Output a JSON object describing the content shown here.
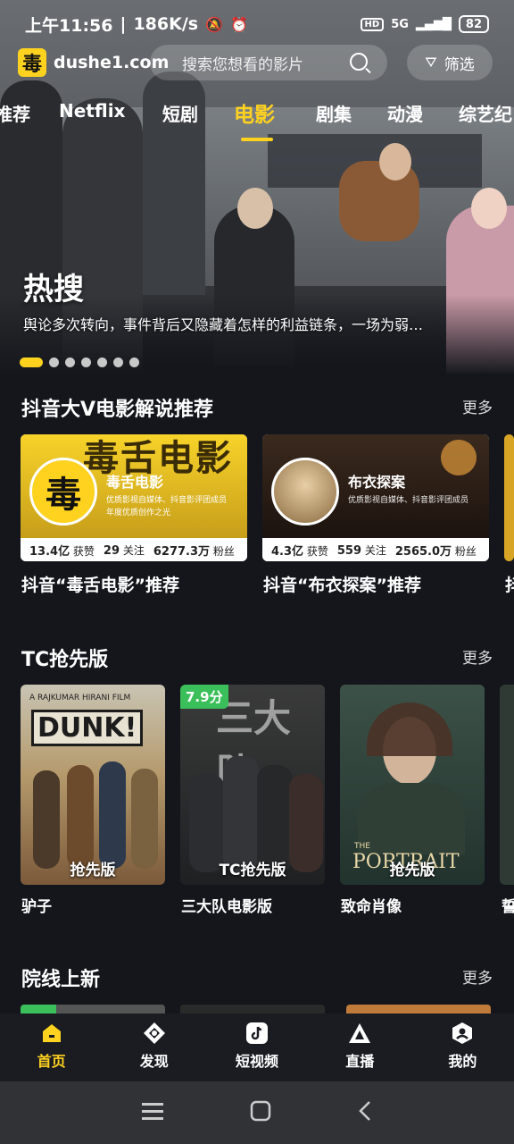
{
  "status_bar": {
    "time": "上午11:56",
    "speed": "186K/s",
    "hd": "HD",
    "network": "5G",
    "battery": "82"
  },
  "header": {
    "site": "dushe1.com",
    "logo_char": "毒",
    "search_placeholder": "搜索您想看的影片",
    "filter_label": "筛选"
  },
  "tabs": [
    "推荐",
    "Netflix",
    "短剧",
    "电影",
    "剧集",
    "动漫",
    "综艺纪"
  ],
  "active_tab": "电影",
  "hero": {
    "title": "热搜",
    "description": "舆论多次转向，事件背后又隐藏着怎样的利益链条，一场为弱…",
    "slide_count": 7,
    "active_slide": 0
  },
  "sections": {
    "v_title": "抖音大V电影解说推荐",
    "v_more": "更多",
    "v_cards": [
      {
        "banner": "毒舌电影",
        "name": "毒舌电影",
        "line1": "优质影视自媒体、抖音影评团成员",
        "line2": "年度优质创作之光",
        "likes": "13.4亿",
        "likes_label": "获赞",
        "follows": "29",
        "follows_label": "关注",
        "fans": "6277.3万",
        "fans_label": "粉丝",
        "caption": "抖音“毒舌电影”推荐"
      },
      {
        "banner": "",
        "name": "布衣探案",
        "line1": "优质影视自媒体、抖音影评团成员",
        "line2": "",
        "likes": "4.3亿",
        "likes_label": "获赞",
        "follows": "559",
        "follows_label": "关注",
        "fans": "2565.0万",
        "fans_label": "粉丝",
        "caption": "抖音“布衣探案”推荐"
      }
    ],
    "v_caption_partial": "抖",
    "tc_title": "TC抢先版",
    "tc_more": "更多",
    "tc_movies": [
      {
        "title": "驴子",
        "tag": "抢先版",
        "poster_text": "DUNK!",
        "poster_credit": "A RAJKUMAR HIRANI FILM",
        "score": ""
      },
      {
        "title": "三大队电影版",
        "tag": "TC抢先版",
        "poster_text": "三大队",
        "poster_credit": "",
        "score": "7.9分"
      },
      {
        "title": "致命肖像",
        "tag": "抢先版",
        "poster_text": "PORTRAIT",
        "poster_credit": "THE",
        "score": ""
      }
    ],
    "tc_caption_partial": "誓",
    "new_title": "院线上新",
    "new_more": "更多"
  },
  "bottom_nav": [
    {
      "label": "首页",
      "icon": "home-icon"
    },
    {
      "label": "发现",
      "icon": "discover-icon"
    },
    {
      "label": "短视频",
      "icon": "tiktok-icon"
    },
    {
      "label": "直播",
      "icon": "live-icon"
    },
    {
      "label": "我的",
      "icon": "profile-icon"
    }
  ],
  "colors": {
    "accent": "#ffd21f",
    "background": "#14161c",
    "score_green": "#3bbf5a"
  }
}
